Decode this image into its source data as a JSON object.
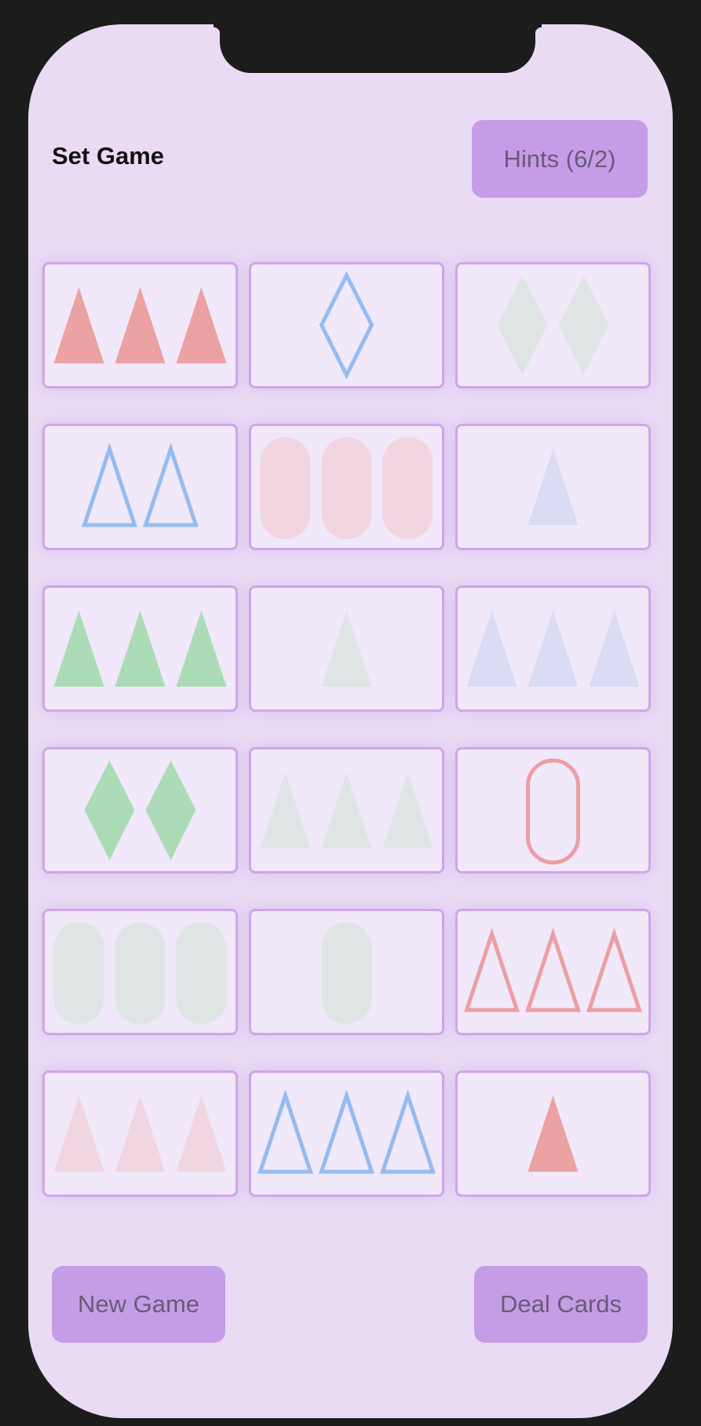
{
  "header": {
    "title": "Set Game",
    "hints_label": "Hints (6/2)"
  },
  "footer": {
    "new_game_label": "New Game",
    "deal_cards_label": "Deal Cards"
  },
  "colors": {
    "red_solid": "#eca1a3",
    "red_light": "#f1d6e2",
    "red_outline": "#eb9fa2",
    "blue_outline": "#95bcf2",
    "blue_light": "#dadcf6",
    "green_solid": "#acdbb7",
    "green_light": "#dfe5e4"
  },
  "cards": [
    {
      "count": 3,
      "shape": "triangle",
      "fill": "solid",
      "color": "red_solid"
    },
    {
      "count": 1,
      "shape": "diamond",
      "fill": "outline",
      "color": "blue_outline"
    },
    {
      "count": 2,
      "shape": "diamond",
      "fill": "solid",
      "color": "green_light"
    },
    {
      "count": 2,
      "shape": "triangle",
      "fill": "outline",
      "color": "blue_outline"
    },
    {
      "count": 3,
      "shape": "oval",
      "fill": "solid",
      "color": "red_light"
    },
    {
      "count": 1,
      "shape": "triangle",
      "fill": "solid",
      "color": "blue_light"
    },
    {
      "count": 3,
      "shape": "triangle",
      "fill": "solid",
      "color": "green_solid"
    },
    {
      "count": 1,
      "shape": "triangle",
      "fill": "solid",
      "color": "green_light"
    },
    {
      "count": 3,
      "shape": "triangle",
      "fill": "solid",
      "color": "blue_light"
    },
    {
      "count": 2,
      "shape": "diamond",
      "fill": "solid",
      "color": "green_solid"
    },
    {
      "count": 3,
      "shape": "triangle",
      "fill": "solid",
      "color": "green_light"
    },
    {
      "count": 1,
      "shape": "oval",
      "fill": "outline",
      "color": "red_outline"
    },
    {
      "count": 3,
      "shape": "oval",
      "fill": "solid",
      "color": "green_light"
    },
    {
      "count": 1,
      "shape": "oval",
      "fill": "solid",
      "color": "green_light"
    },
    {
      "count": 3,
      "shape": "triangle",
      "fill": "outline",
      "color": "red_outline"
    },
    {
      "count": 3,
      "shape": "triangle",
      "fill": "solid",
      "color": "red_light"
    },
    {
      "count": 3,
      "shape": "triangle",
      "fill": "outline",
      "color": "blue_outline"
    },
    {
      "count": 1,
      "shape": "triangle",
      "fill": "solid",
      "color": "red_solid"
    }
  ]
}
